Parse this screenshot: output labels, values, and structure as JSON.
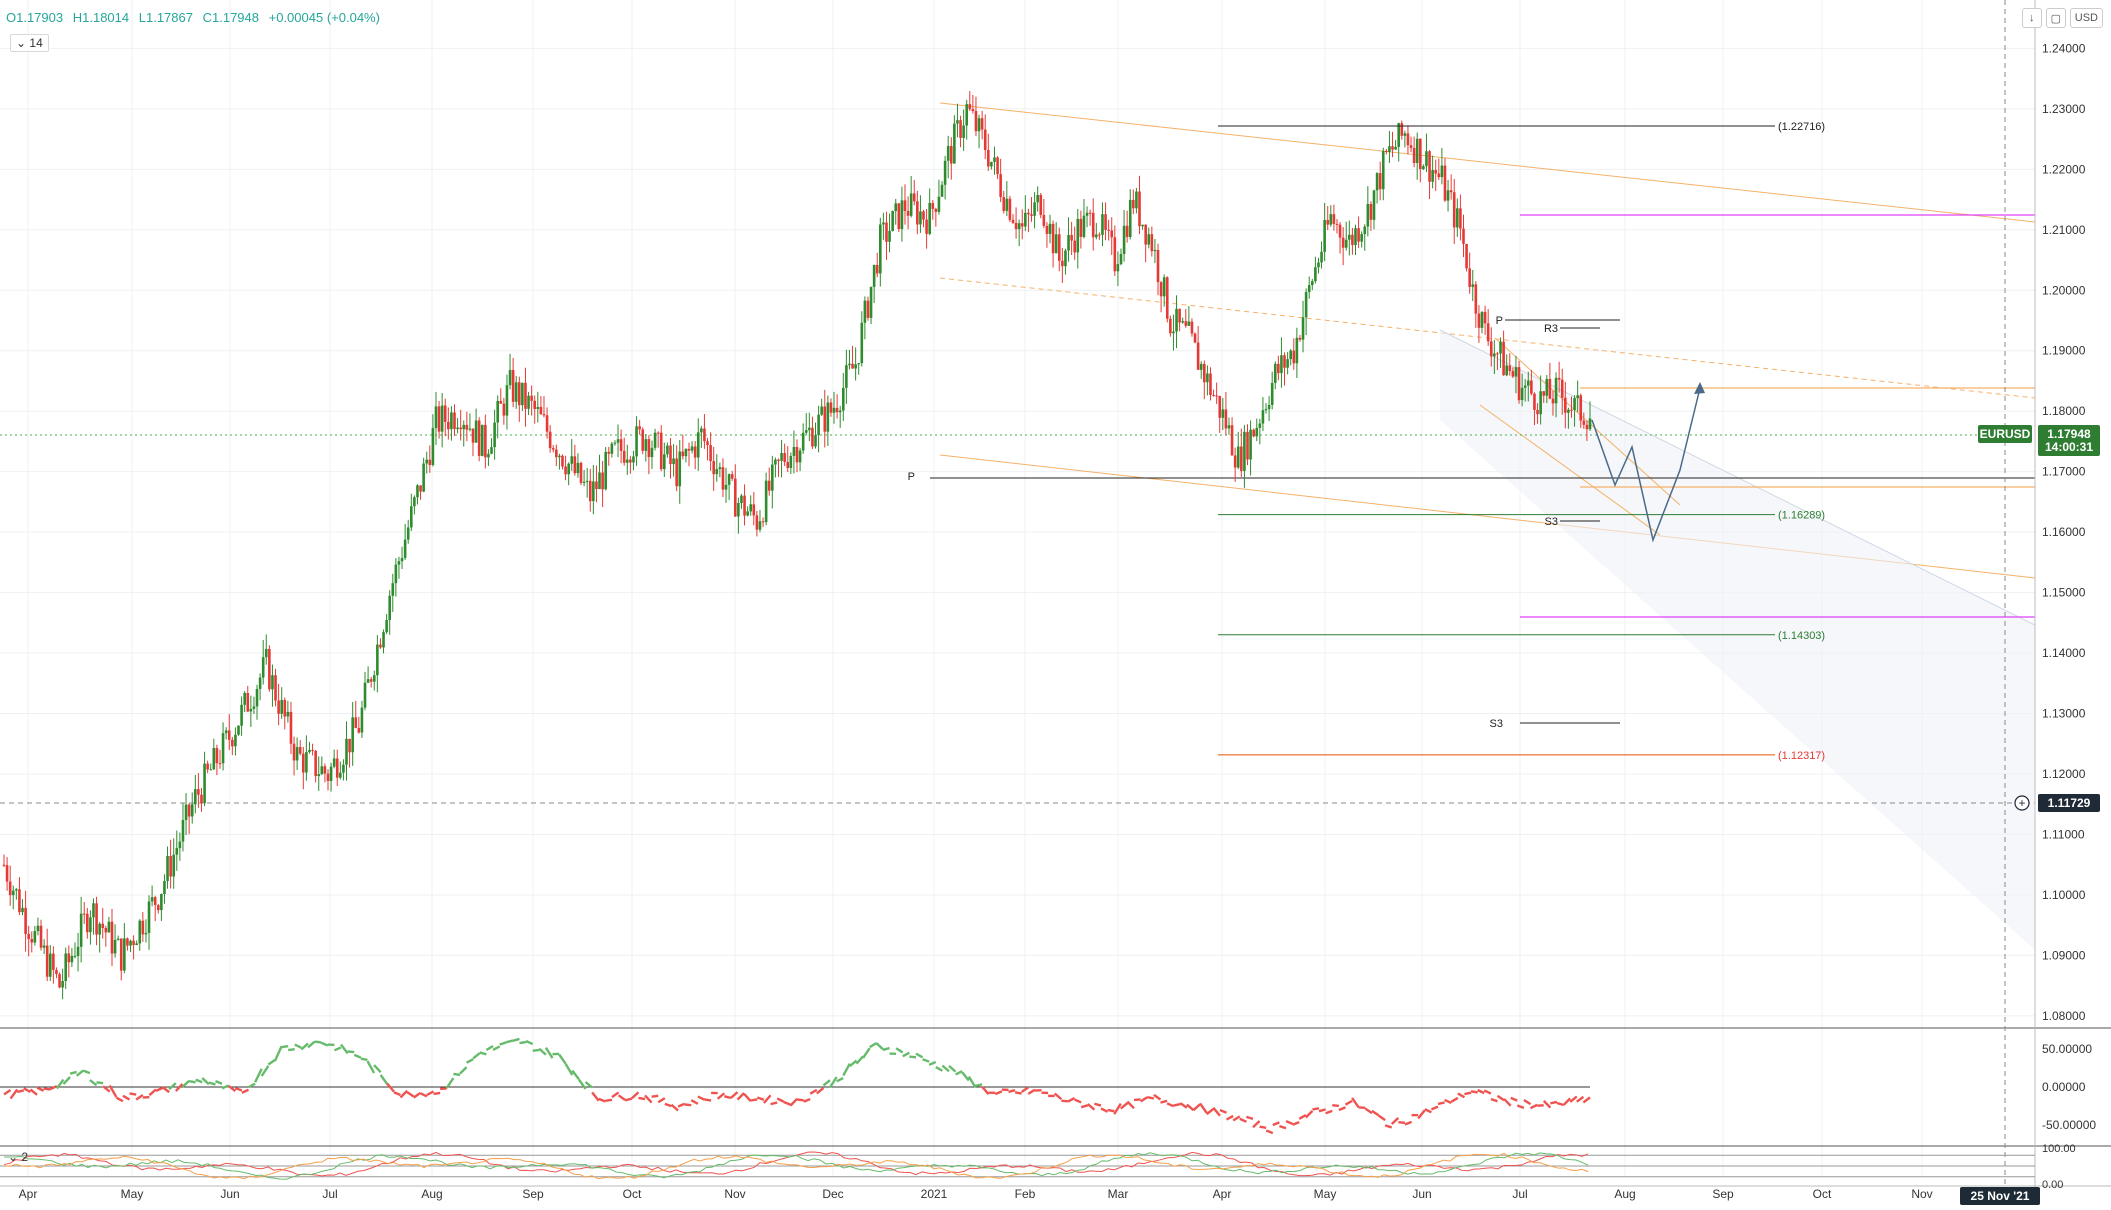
{
  "ohlc": {
    "open": "O1.17903",
    "high": "H1.18014",
    "low": "L1.17867",
    "close": "C1.17948",
    "change": "+0.00045 (+0.04%)"
  },
  "indicator_label": "14",
  "indicator2_label": "2",
  "currency_button": "USD",
  "symbol_label": "EURUSD",
  "price_label": "1.17948",
  "countdown_label": "14:00:31",
  "crosshair_price": "1.11729",
  "crosshair_date": "25 Nov '21",
  "colors": {
    "up": "#26a69a",
    "down": "#ef5350",
    "green_candle": "#2e8b2e",
    "red_candle": "#e53935"
  },
  "chart_data": {
    "type": "candlestick",
    "price_axis_ticks": [
      "1.24000",
      "1.23000",
      "1.22000",
      "1.21000",
      "1.20000",
      "1.19000",
      "1.18000",
      "1.17000",
      "1.16000",
      "1.15000",
      "1.14000",
      "1.13000",
      "1.12000",
      "1.11000",
      "1.10000",
      "1.09000",
      "1.08000"
    ],
    "ylim": [
      1.078,
      1.248
    ],
    "time_axis_ticks": [
      "Apr",
      "May",
      "Jun",
      "Jul",
      "Aug",
      "Sep",
      "Oct",
      "Nov",
      "Dec",
      "2021",
      "Feb",
      "Mar",
      "Apr",
      "May",
      "Jun",
      "Jul",
      "Aug",
      "Sep",
      "Oct",
      "Nov"
    ],
    "price_path": [
      [
        0,
        1.105
      ],
      [
        8,
        1.095
      ],
      [
        18,
        1.085
      ],
      [
        28,
        1.098
      ],
      [
        38,
        1.09
      ],
      [
        50,
        1.1
      ],
      [
        62,
        1.116
      ],
      [
        75,
        1.128
      ],
      [
        85,
        1.138
      ],
      [
        95,
        1.123
      ],
      [
        105,
        1.12
      ],
      [
        115,
        1.128
      ],
      [
        125,
        1.15
      ],
      [
        135,
        1.168
      ],
      [
        140,
        1.178
      ],
      [
        148,
        1.18
      ],
      [
        156,
        1.174
      ],
      [
        164,
        1.184
      ],
      [
        172,
        1.18
      ],
      [
        182,
        1.172
      ],
      [
        190,
        1.166
      ],
      [
        198,
        1.173
      ],
      [
        208,
        1.176
      ],
      [
        218,
        1.17
      ],
      [
        226,
        1.176
      ],
      [
        236,
        1.166
      ],
      [
        244,
        1.162
      ],
      [
        252,
        1.172
      ],
      [
        260,
        1.176
      ],
      [
        268,
        1.18
      ],
      [
        276,
        1.188
      ],
      [
        284,
        1.208
      ],
      [
        292,
        1.214
      ],
      [
        300,
        1.212
      ],
      [
        306,
        1.222
      ],
      [
        312,
        1.23
      ],
      [
        318,
        1.224
      ],
      [
        324,
        1.216
      ],
      [
        330,
        1.21
      ],
      [
        336,
        1.215
      ],
      [
        342,
        1.205
      ],
      [
        348,
        1.21
      ],
      [
        354,
        1.212
      ],
      [
        360,
        1.205
      ],
      [
        366,
        1.215
      ],
      [
        372,
        1.208
      ],
      [
        378,
        1.195
      ],
      [
        384,
        1.192
      ],
      [
        390,
        1.185
      ],
      [
        396,
        1.178
      ],
      [
        400,
        1.172
      ],
      [
        406,
        1.178
      ],
      [
        412,
        1.186
      ],
      [
        418,
        1.19
      ],
      [
        424,
        1.202
      ],
      [
        430,
        1.212
      ],
      [
        436,
        1.208
      ],
      [
        442,
        1.213
      ],
      [
        448,
        1.222
      ],
      [
        454,
        1.226
      ],
      [
        460,
        1.222
      ],
      [
        466,
        1.218
      ],
      [
        472,
        1.21
      ],
      [
        476,
        1.2
      ],
      [
        480,
        1.193
      ],
      [
        486,
        1.188
      ],
      [
        492,
        1.184
      ],
      [
        498,
        1.182
      ],
      [
        504,
        1.183
      ],
      [
        510,
        1.18
      ],
      [
        514,
        1.1795
      ]
    ],
    "levels": [
      {
        "label": "(1.22716)",
        "value": 1.22716
      },
      {
        "label": "(1.16289)",
        "value": 1.16289
      },
      {
        "label": "(1.14303)",
        "value": 1.14303
      },
      {
        "label": "(1.12317)",
        "value": 1.12317
      }
    ],
    "pivot_labels": [
      "P",
      "R3",
      "S3",
      "S3",
      "P"
    ],
    "oscillator1": {
      "ticks": [
        "50.00000",
        "0.00000",
        "-50.00000"
      ],
      "ylim": [
        -75,
        75
      ],
      "path": [
        [
          0,
          -10
        ],
        [
          20,
          -5
        ],
        [
          40,
          20
        ],
        [
          60,
          -15
        ],
        [
          80,
          -5
        ],
        [
          100,
          10
        ],
        [
          120,
          -10
        ],
        [
          140,
          50
        ],
        [
          160,
          60
        ],
        [
          180,
          40
        ],
        [
          200,
          -10
        ],
        [
          220,
          -5
        ],
        [
          240,
          45
        ],
        [
          260,
          60
        ],
        [
          280,
          40
        ],
        [
          300,
          -15
        ],
        [
          320,
          -10
        ],
        [
          340,
          -25
        ],
        [
          360,
          -10
        ],
        [
          380,
          -15
        ],
        [
          400,
          -20
        ],
        [
          420,
          10
        ],
        [
          440,
          55
        ],
        [
          460,
          40
        ],
        [
          480,
          20
        ],
        [
          500,
          -10
        ],
        [
          520,
          -5
        ],
        [
          540,
          -20
        ],
        [
          560,
          -30
        ],
        [
          580,
          -15
        ],
        [
          600,
          -25
        ],
        [
          620,
          -40
        ],
        [
          640,
          -55
        ],
        [
          660,
          -35
        ],
        [
          680,
          -20
        ],
        [
          700,
          -50
        ],
        [
          720,
          -30
        ],
        [
          740,
          -5
        ],
        [
          760,
          -20
        ],
        [
          780,
          -25
        ],
        [
          800,
          -15
        ]
      ]
    },
    "oscillator2": {
      "ticks": [
        "100.00",
        "0.00"
      ],
      "ylim": [
        0,
        100
      ]
    }
  }
}
